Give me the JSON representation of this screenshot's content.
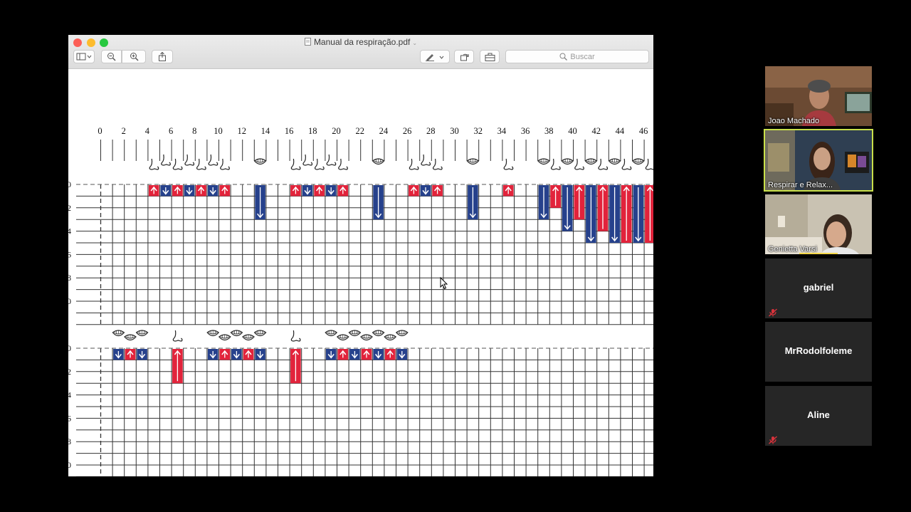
{
  "window": {
    "title": "Manual da respiração.pdf",
    "search_placeholder": "Buscar"
  },
  "chart_data": {
    "type": "table",
    "x_ticks": [
      0,
      2,
      4,
      6,
      8,
      10,
      12,
      14,
      16,
      18,
      20,
      22,
      24,
      26,
      28,
      30,
      32,
      34,
      36,
      38,
      40,
      42,
      44,
      46
    ],
    "y_ticks": [
      "0",
      "2",
      "4",
      "6",
      "8",
      "0"
    ],
    "legend": {
      "inhale": "up arrow, red",
      "exhale": "down arrow, blue",
      "nose": "nose icon",
      "mouth": "mouth icon"
    },
    "colors": {
      "inhale": "#e2233b",
      "exhale": "#26418c"
    },
    "rows": [
      {
        "events": [
          {
            "col": 4,
            "dir": "up",
            "len": 1,
            "via": "nose"
          },
          {
            "col": 5,
            "dir": "down",
            "len": 1,
            "via": "nose"
          },
          {
            "col": 6,
            "dir": "up",
            "len": 1,
            "via": "nose"
          },
          {
            "col": 7,
            "dir": "down",
            "len": 1,
            "via": "nose"
          },
          {
            "col": 8,
            "dir": "up",
            "len": 1,
            "via": "nose"
          },
          {
            "col": 9,
            "dir": "down",
            "len": 1,
            "via": "nose"
          },
          {
            "col": 10,
            "dir": "up",
            "len": 1,
            "via": "nose"
          },
          {
            "col": 13,
            "dir": "down",
            "len": 3,
            "via": "mouth"
          },
          {
            "col": 16,
            "dir": "up",
            "len": 1,
            "via": "nose"
          },
          {
            "col": 17,
            "dir": "down",
            "len": 1,
            "via": "nose"
          },
          {
            "col": 18,
            "dir": "up",
            "len": 1,
            "via": "nose"
          },
          {
            "col": 19,
            "dir": "down",
            "len": 1,
            "via": "nose"
          },
          {
            "col": 20,
            "dir": "up",
            "len": 1,
            "via": "nose"
          },
          {
            "col": 23,
            "dir": "down",
            "len": 3,
            "via": "mouth"
          },
          {
            "col": 26,
            "dir": "up",
            "len": 1,
            "via": "nose"
          },
          {
            "col": 27,
            "dir": "down",
            "len": 1,
            "via": "nose"
          },
          {
            "col": 28,
            "dir": "up",
            "len": 1,
            "via": "nose"
          },
          {
            "col": 31,
            "dir": "down",
            "len": 3,
            "via": "mouth"
          },
          {
            "col": 34,
            "dir": "up",
            "len": 1,
            "via": "nose"
          },
          {
            "col": 37,
            "dir": "down",
            "len": 3,
            "via": "mouth"
          },
          {
            "col": 38,
            "dir": "up",
            "len": 2,
            "via": "nose"
          },
          {
            "col": 39,
            "dir": "down",
            "len": 4,
            "via": "mouth"
          },
          {
            "col": 40,
            "dir": "up",
            "len": 3,
            "via": "nose"
          },
          {
            "col": 41,
            "dir": "down",
            "len": 5,
            "via": "mouth"
          },
          {
            "col": 42,
            "dir": "up",
            "len": 4,
            "via": "nose"
          },
          {
            "col": 43,
            "dir": "down",
            "len": 5,
            "via": "mouth"
          },
          {
            "col": 44,
            "dir": "up",
            "len": 5,
            "via": "nose"
          },
          {
            "col": 45,
            "dir": "down",
            "len": 5,
            "via": "mouth"
          },
          {
            "col": 46,
            "dir": "up",
            "len": 5,
            "via": "nose"
          },
          {
            "col": 47,
            "dir": "down",
            "len": 5,
            "via": "mouth"
          }
        ]
      },
      {
        "events": [
          {
            "col": 1,
            "dir": "down",
            "len": 1,
            "via": "mouth"
          },
          {
            "col": 2,
            "dir": "up",
            "len": 1,
            "via": "mouth"
          },
          {
            "col": 3,
            "dir": "down",
            "len": 1,
            "via": "mouth"
          },
          {
            "col": 6,
            "dir": "up",
            "len": 3,
            "via": "nose"
          },
          {
            "col": 9,
            "dir": "down",
            "len": 1,
            "via": "mouth"
          },
          {
            "col": 10,
            "dir": "up",
            "len": 1,
            "via": "mouth"
          },
          {
            "col": 11,
            "dir": "down",
            "len": 1,
            "via": "mouth"
          },
          {
            "col": 12,
            "dir": "up",
            "len": 1,
            "via": "mouth"
          },
          {
            "col": 13,
            "dir": "down",
            "len": 1,
            "via": "mouth"
          },
          {
            "col": 16,
            "dir": "up",
            "len": 3,
            "via": "nose"
          },
          {
            "col": 19,
            "dir": "down",
            "len": 1,
            "via": "mouth"
          },
          {
            "col": 20,
            "dir": "up",
            "len": 1,
            "via": "mouth"
          },
          {
            "col": 21,
            "dir": "down",
            "len": 1,
            "via": "mouth"
          },
          {
            "col": 22,
            "dir": "up",
            "len": 1,
            "via": "mouth"
          },
          {
            "col": 23,
            "dir": "down",
            "len": 1,
            "via": "mouth"
          },
          {
            "col": 24,
            "dir": "up",
            "len": 1,
            "via": "mouth"
          },
          {
            "col": 25,
            "dir": "down",
            "len": 1,
            "via": "mouth"
          }
        ]
      }
    ]
  },
  "participants": [
    {
      "name": "Joao Machado",
      "video": true
    },
    {
      "name": "Respirar e Relax...",
      "video": true,
      "active": true
    },
    {
      "name": "Genietta Varsi",
      "video": true
    },
    {
      "name": "gabriel",
      "video": false,
      "muted": true
    },
    {
      "name": "MrRodolfoleme",
      "video": false,
      "muted": false
    },
    {
      "name": "Aline",
      "video": false,
      "muted": true
    }
  ]
}
